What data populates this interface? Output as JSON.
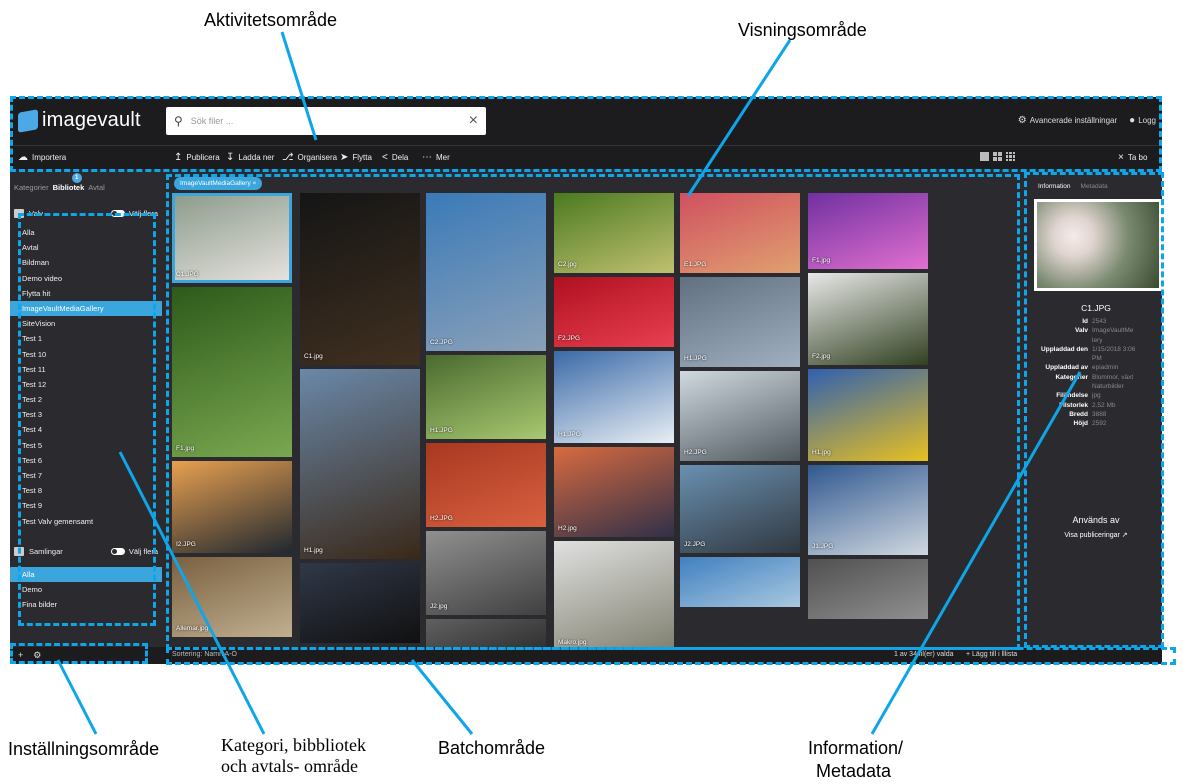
{
  "annotations": {
    "aktivitet": "Aktivitetsområde",
    "visning": "Visningsområde",
    "installning": "Inställningsområde",
    "kategori_line1": "Kategori, bibbliotek",
    "kategori_line2": "och avtals- område",
    "batch": "Batchområde",
    "info_line1": "Information/",
    "info_line2": "Metadata"
  },
  "app": {
    "logo": "imagevault",
    "search_placeholder": "Sök filer ...",
    "advanced_settings": "Avancerade inställningar",
    "logout": "Logg",
    "colors": {
      "accent": "#3aa6dd",
      "dash": "#0ea5e9",
      "bg": "#2b2b2f",
      "topbar": "#1c1c1e"
    }
  },
  "toolbar": {
    "importera": "Importera",
    "publicera": "Publicera",
    "ladda_ner": "Ladda ner",
    "organisera": "Organisera",
    "flytta": "Flytta",
    "dela": "Dela",
    "mer": "Mer",
    "close_label": "Ta bo"
  },
  "sidebar": {
    "tabs": [
      "Kategorier",
      "Bibliotek",
      "Avtal"
    ],
    "badge": "1",
    "vaults_title": "Valv",
    "choose_many": "Välj flera",
    "vaults": [
      "Alla",
      "Avtal",
      "Bildman",
      "Demo video",
      "Flytta hit",
      "ImageVaultMediaGallery",
      "SiteVision",
      "Test 1",
      "Test 10",
      "Test 11",
      "Test 12",
      "Test 2",
      "Test 3",
      "Test 4",
      "Test 5",
      "Test 6",
      "Test 7",
      "Test 8",
      "Test 9",
      "Test Valv gemensamt"
    ],
    "selected_vault_index": 5,
    "collections_title": "Samlingar",
    "collections": [
      "Alla",
      "Demo",
      "Fina bilder"
    ],
    "selected_collection_index": 0
  },
  "gallery": {
    "filter_chip": "ImageVaultMediaGallery",
    "columns": [
      [
        {
          "cap": "C1.JPG",
          "c1": "#8a9a8a",
          "c2": "#e8e4e0",
          "h": 90,
          "sel": true
        },
        {
          "cap": "F1.jpg",
          "c1": "#2d5a1a",
          "c2": "#7aa850",
          "h": 170
        },
        {
          "cap": "I2.JPG",
          "c1": "#e8a050",
          "c2": "#202830",
          "h": 92
        },
        {
          "cap": "Allemar.jpg",
          "c1": "#7a6040",
          "c2": "#c0b090",
          "h": 80
        }
      ],
      [
        {
          "cap": "C1.jpg",
          "c1": "#151515",
          "c2": "#403020",
          "h": 172
        },
        {
          "cap": "H1.jpg",
          "c1": "#6a88a8",
          "c2": "#3a2818",
          "h": 190
        },
        {
          "cap": "",
          "c1": "#303848",
          "c2": "#101010",
          "h": 80
        }
      ],
      [
        {
          "cap": "C2.JPG",
          "c1": "#3a7ab8",
          "c2": "#8aa0b8",
          "h": 158
        },
        {
          "cap": "H1.JPG",
          "c1": "#4a6a30",
          "c2": "#a8c870",
          "h": 84
        },
        {
          "cap": "H2.JPG",
          "c1": "#a83820",
          "c2": "#d86040",
          "h": 84
        },
        {
          "cap": "J2.jpg",
          "c1": "#909090",
          "c2": "#404040",
          "h": 84
        },
        {
          "cap": "",
          "c1": "#606060",
          "c2": "#303030",
          "h": 30
        }
      ],
      [
        {
          "cap": "C2.jpg",
          "c1": "#4a7a20",
          "c2": "#c0c070",
          "h": 80
        },
        {
          "cap": "F2.JPG",
          "c1": "#b01020",
          "c2": "#e84050",
          "h": 70
        },
        {
          "cap": "H1.JPG",
          "c1": "#3a6aa8",
          "c2": "#e8eef4",
          "h": 92
        },
        {
          "cap": "H2.jpg",
          "c1": "#d86a40",
          "c2": "#303048",
          "h": 90
        },
        {
          "cap": "Makro.jpg",
          "c1": "#e0e0e0",
          "c2": "#808070",
          "h": 110
        }
      ],
      [
        {
          "cap": "E1.JPG",
          "c1": "#d05060",
          "c2": "#e0a070",
          "h": 80
        },
        {
          "cap": "H1.JPG",
          "c1": "#607080",
          "c2": "#a0b0c0",
          "h": 90
        },
        {
          "cap": "H2.JPG",
          "c1": "#d0d8e0",
          "c2": "#505860",
          "h": 90
        },
        {
          "cap": "J2.JPG",
          "c1": "#6a90b0",
          "c2": "#303840",
          "h": 88
        },
        {
          "cap": "",
          "c1": "#4080c0",
          "c2": "#a8c8e0",
          "h": 50
        }
      ],
      [
        {
          "cap": "F1.jpg",
          "c1": "#7030a0",
          "c2": "#e070d0",
          "h": 76
        },
        {
          "cap": "F2.jpg",
          "c1": "#e8e8e8",
          "c2": "#304020",
          "h": 92
        },
        {
          "cap": "H1.jpg",
          "c1": "#3060b0",
          "c2": "#e8c020",
          "h": 92
        },
        {
          "cap": "J1.JPG",
          "c1": "#305890",
          "c2": "#d0d8e0",
          "h": 90
        },
        {
          "cap": "",
          "c1": "#505050",
          "c2": "#909090",
          "h": 60
        }
      ]
    ]
  },
  "info": {
    "tabs": [
      "Information",
      "Metadata"
    ],
    "title": "C1.JPG",
    "rows": [
      {
        "k": "Id",
        "v": "2543"
      },
      {
        "k": "Valv",
        "v": "ImageVaultMe"
      },
      {
        "k": "",
        "v": "lery"
      },
      {
        "k": "Uppladdad den",
        "v": "1/15/2018 3:06"
      },
      {
        "k": "",
        "v": "PM"
      },
      {
        "k": "Uppladdad av",
        "v": "epiadmin"
      },
      {
        "k": "Kategorier",
        "v": "Blommor, växt"
      },
      {
        "k": "",
        "v": "Naturbilder"
      },
      {
        "k": "Filändelse",
        "v": "jpg"
      },
      {
        "k": "Filstorlek",
        "v": "2.52 Mb"
      },
      {
        "k": "Bredd",
        "v": "3888"
      },
      {
        "k": "Höjd",
        "v": "2592"
      }
    ],
    "used_by": "Används av",
    "publications": "Visa publiceringar"
  },
  "bottombar": {
    "sort_label": "Sortering:",
    "sort_value": "Namn A-Ö",
    "selection": "1 av 34 fil(er) valda",
    "add_to_list": "+ Lägg till i lllista"
  }
}
